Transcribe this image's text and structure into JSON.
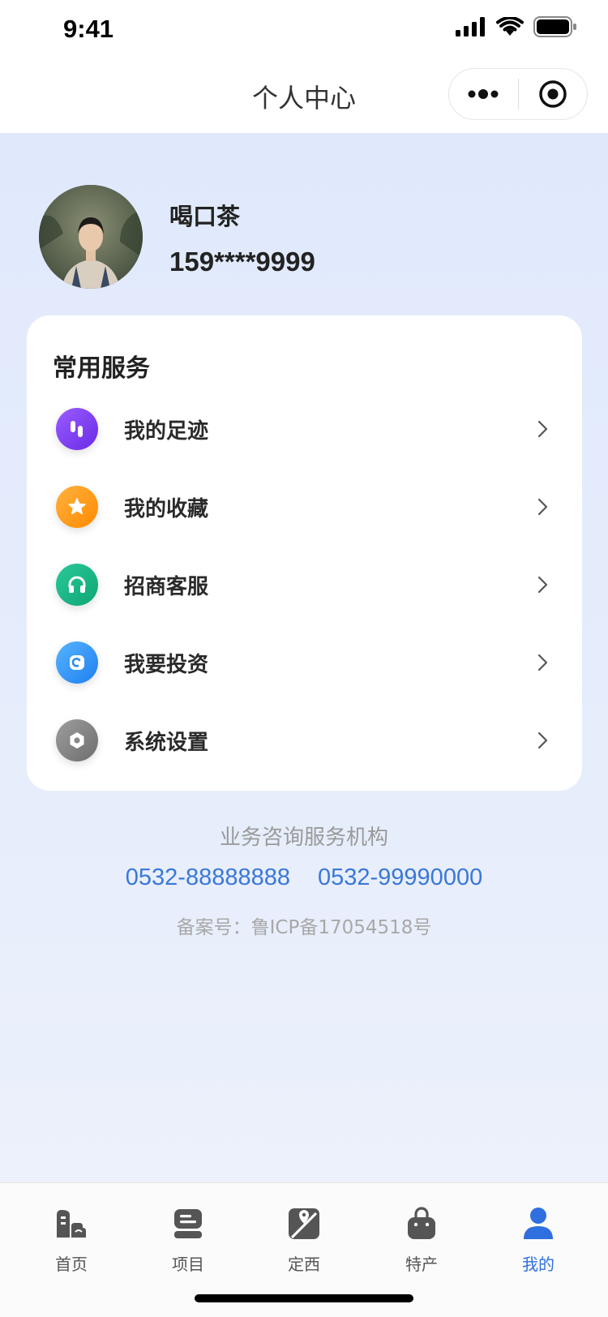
{
  "status_bar": {
    "time": "9:41"
  },
  "nav": {
    "title": "个人中心"
  },
  "profile": {
    "name": "喝口茶",
    "phone": "159****9999"
  },
  "services": {
    "title": "常用服务",
    "items": [
      {
        "label": "我的足迹",
        "icon": "footprint-icon",
        "color": "#7b3ff0"
      },
      {
        "label": "我的收藏",
        "icon": "star-icon",
        "color": "#ff9a1a"
      },
      {
        "label": "招商客服",
        "icon": "headset-icon",
        "color": "#17b585"
      },
      {
        "label": "我要投资",
        "icon": "invest-icon",
        "color": "#2d8cf0"
      },
      {
        "label": "系统设置",
        "icon": "settings-icon",
        "color": "#8a8a8a"
      }
    ]
  },
  "footer": {
    "title": "业务咨询服务机构",
    "phone1": "0532-88888888",
    "phone2": "0532-99990000",
    "icp": "备案号：鲁ICP备17054518号"
  },
  "tabbar": {
    "active_color": "#2f6fe0",
    "tabs": [
      {
        "label": "首页",
        "icon": "home-building-icon"
      },
      {
        "label": "项目",
        "icon": "project-list-icon"
      },
      {
        "label": "定西",
        "icon": "map-location-icon"
      },
      {
        "label": "特产",
        "icon": "shopping-bag-icon"
      },
      {
        "label": "我的",
        "icon": "user-icon",
        "active": true
      }
    ]
  }
}
